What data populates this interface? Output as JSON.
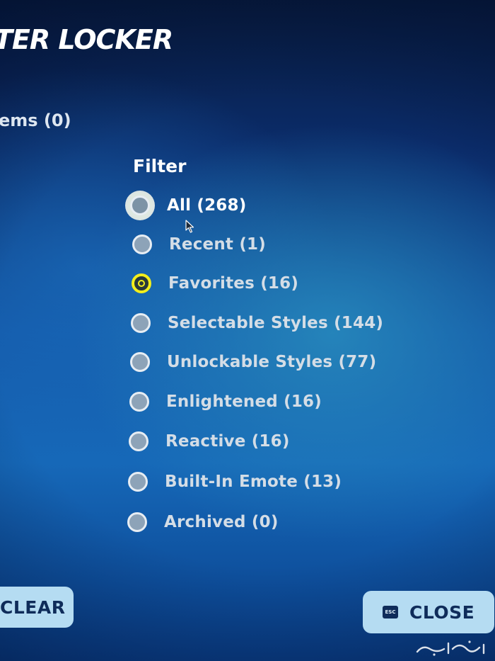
{
  "header": {
    "title": "TER LOCKER",
    "items_count": "ems (0)"
  },
  "filter": {
    "heading": "Filter",
    "options": [
      {
        "label": "All (268)",
        "state": "hovered"
      },
      {
        "label": "Recent (1)",
        "state": "normal"
      },
      {
        "label": "Favorites (16)",
        "state": "selected"
      },
      {
        "label": "Selectable Styles (144)",
        "state": "normal"
      },
      {
        "label": "Unlockable Styles (77)",
        "state": "normal"
      },
      {
        "label": "Enlightened (16)",
        "state": "normal"
      },
      {
        "label": "Reactive (16)",
        "state": "normal"
      },
      {
        "label": "Built-In Emote (13)",
        "state": "normal"
      },
      {
        "label": "Archived (0)",
        "state": "normal"
      }
    ]
  },
  "footer": {
    "clear_label": "CLEAR",
    "close_label": "CLOSE",
    "close_key_hint": "ESC"
  },
  "colors": {
    "selected_ring": "#f3ee1c",
    "radio_fill": "#8da3b8",
    "button_bg": "#b5dcf2",
    "button_text": "#0f2c5a"
  },
  "icons": {
    "cursor": "mouse-pointer-icon",
    "esc": "escape-key-icon",
    "watermark": "haraj-watermark-logo"
  }
}
